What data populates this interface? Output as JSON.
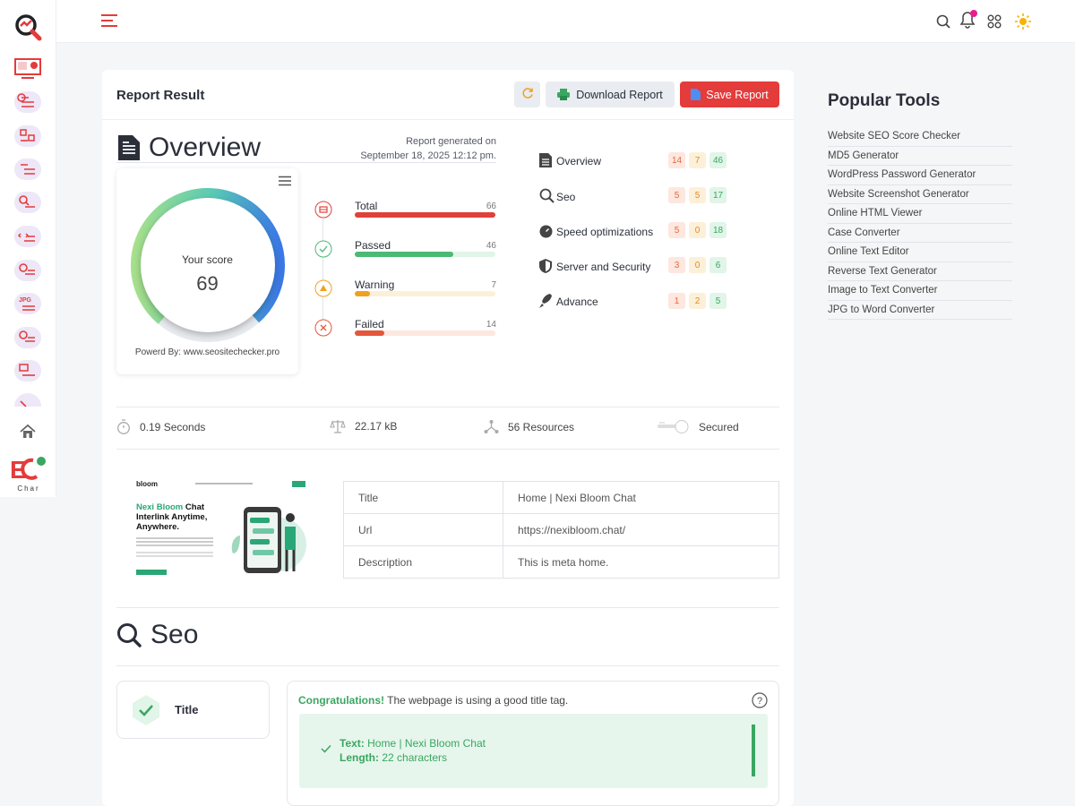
{
  "header": {
    "icons": [
      "menu-icon",
      "search-icon",
      "bell-icon",
      "apps-icon",
      "sun-icon"
    ],
    "notification_dot_color": "#e91e8c"
  },
  "rail": {
    "brand_text": "Char"
  },
  "report": {
    "title": "Report Result",
    "download_label": "Download Report",
    "save_label": "Save Report",
    "overview_title": "Overview",
    "generated_line1": "Report generated on",
    "generated_line2": "September 18, 2025 12:12 pm.",
    "score_label": "Your score",
    "score_value": "69",
    "score_fraction": 0.69,
    "powered_by": "Powerd By: www.seositechecker.pro",
    "metrics": [
      {
        "label": "Total",
        "count": "66",
        "fraction": 1.0,
        "color": "#e0403a",
        "track": "#fbe3e1"
      },
      {
        "label": "Passed",
        "count": "46",
        "fraction": 0.7,
        "color": "#4cb974",
        "track": "#e1f5e8"
      },
      {
        "label": "Warning",
        "count": "7",
        "fraction": 0.11,
        "color": "#f0a020",
        "track": "#fdf0d9"
      },
      {
        "label": "Failed",
        "count": "14",
        "fraction": 0.21,
        "color": "#e4573b",
        "track": "#fde7df"
      }
    ],
    "categories": [
      {
        "name": "Overview",
        "fail": "14",
        "warn": "7",
        "pass": "46"
      },
      {
        "name": "Seo",
        "fail": "5",
        "warn": "5",
        "pass": "17"
      },
      {
        "name": "Speed optimizations",
        "fail": "5",
        "warn": "0",
        "pass": "18"
      },
      {
        "name": "Server and Security",
        "fail": "3",
        "warn": "0",
        "pass": "6"
      },
      {
        "name": "Advance",
        "fail": "1",
        "warn": "2",
        "pass": "5"
      }
    ],
    "stats": {
      "time": "0.19 Seconds",
      "size": "22.17 kB",
      "resources": "56 Resources",
      "security": "Secured"
    },
    "screenshot": {
      "brand": "bloom",
      "headline_part1": "Nexi Bloom",
      "headline_part2": " Chat",
      "headline_line2": "Interlink Anytime,",
      "headline_line3": "Anywhere."
    },
    "meta_rows": [
      {
        "key": "Title",
        "value": "Home | Nexi Bloom Chat"
      },
      {
        "key": "Url",
        "value": "https://nexibloom.chat/"
      },
      {
        "key": "Description",
        "value": "This is meta home."
      }
    ],
    "seo_title": "Seo",
    "check": {
      "name": "Title",
      "msg_strong": "Congratulations!",
      "msg_rest": " The webpage is using a good title tag.",
      "text_label": "Text:",
      "text_value": " Home | Nexi Bloom Chat",
      "length_label": "Length:",
      "length_value": " 22 characters"
    }
  },
  "popular": {
    "title": "Popular Tools",
    "items": [
      "Website SEO Score Checker",
      "MD5 Generator",
      "WordPress Password Generator",
      "Website Screenshot Generator",
      "Online HTML Viewer",
      "Case Converter",
      "Online Text Editor",
      "Reverse Text Generator",
      "Image to Text Converter",
      "JPG to Word Converter"
    ]
  }
}
